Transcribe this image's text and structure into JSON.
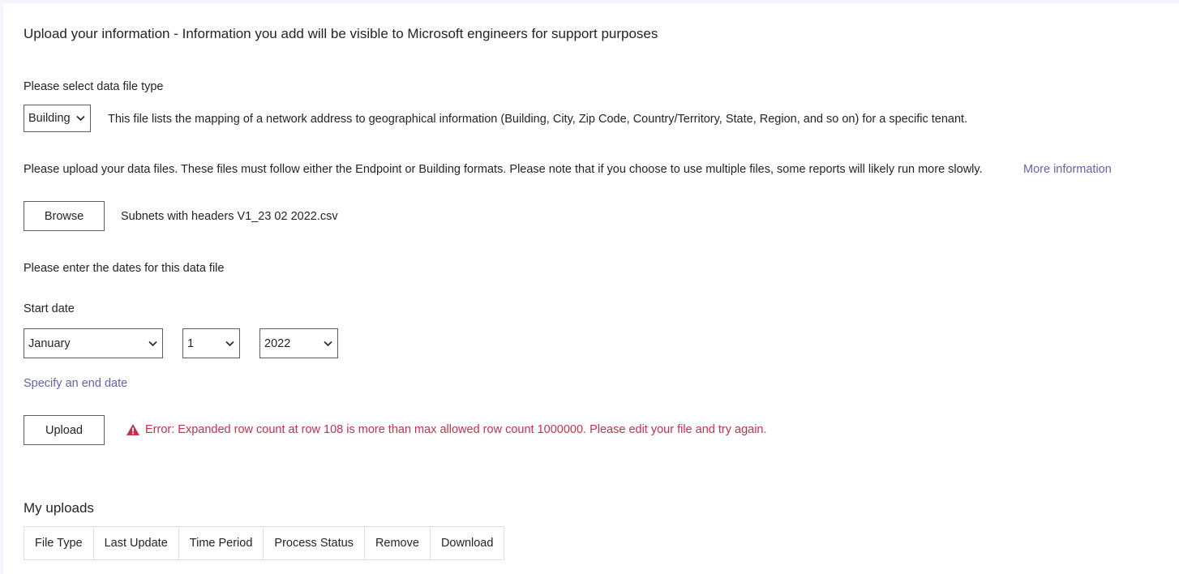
{
  "header": {
    "title": "Upload your information - Information you add will be visible to Microsoft engineers for support purposes"
  },
  "file_type": {
    "label": "Please select data file type",
    "selected": "Building",
    "description": "This file lists the mapping of a network address to geographical information (Building, City, Zip Code, Country/Territory, State, Region, and so on) for a specific tenant."
  },
  "upload_files": {
    "instructions": "Please upload your data files. These files must follow either the Endpoint or Building formats. Please note that if you choose to use multiple files, some reports will likely run more slowly.",
    "more_info_link": "More information",
    "browse_label": "Browse",
    "file_name": "Subnets with headers V1_23 02 2022.csv"
  },
  "dates": {
    "prompt": "Please enter the dates for this data file",
    "start_label": "Start date",
    "month": "January",
    "day": "1",
    "year": "2022",
    "end_date_link": "Specify an end date"
  },
  "upload": {
    "button_label": "Upload",
    "error_message": "Error: Expanded row count at row 108 is more than max allowed row count 1000000. Please edit your file and try again.",
    "error_color": "#c4314b"
  },
  "my_uploads": {
    "title": "My uploads",
    "columns": [
      "File Type",
      "Last Update",
      "Time Period",
      "Process Status",
      "Remove",
      "Download"
    ]
  },
  "colors": {
    "link": "#6264a7",
    "border": "#605e5c"
  }
}
